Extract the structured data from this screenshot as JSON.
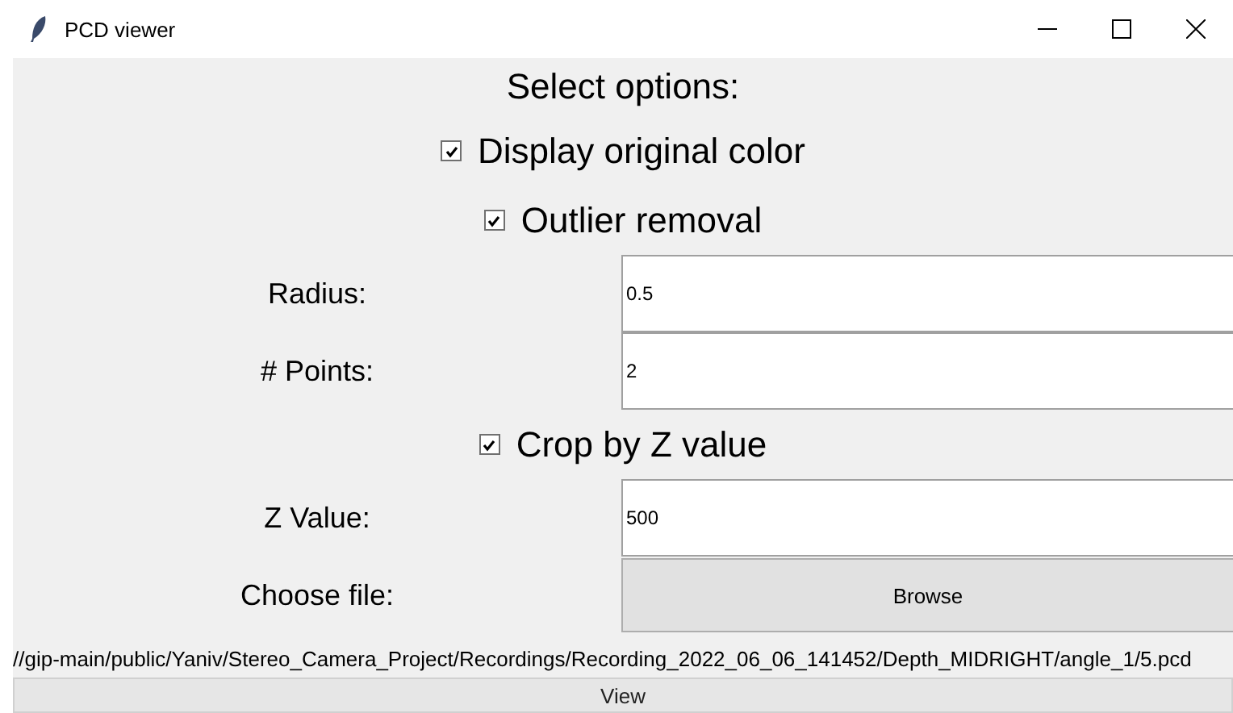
{
  "window": {
    "title": "PCD viewer"
  },
  "heading": "Select options:",
  "rows": [
    {
      "kind": "checkbox",
      "label": "Display original color",
      "checked": true
    },
    {
      "kind": "checkbox",
      "label": "Outlier removal",
      "checked": true
    },
    {
      "kind": "entry",
      "label": "Radius:",
      "value": "0.5"
    },
    {
      "kind": "entry",
      "label": "# Points:",
      "value": "2"
    },
    {
      "kind": "checkbox",
      "label": "Crop by Z value",
      "checked": true
    },
    {
      "kind": "entry",
      "label": "Z Value:",
      "value": "500"
    },
    {
      "kind": "file",
      "label": "Choose file:",
      "button": "Browse"
    }
  ],
  "file_path": "//gip-main/public/Yaniv/Stereo_Camera_Project/Recordings/Recording_2022_06_06_141452/Depth_MIDRIGHT/angle_1/5.pcd",
  "view_button": "View"
}
